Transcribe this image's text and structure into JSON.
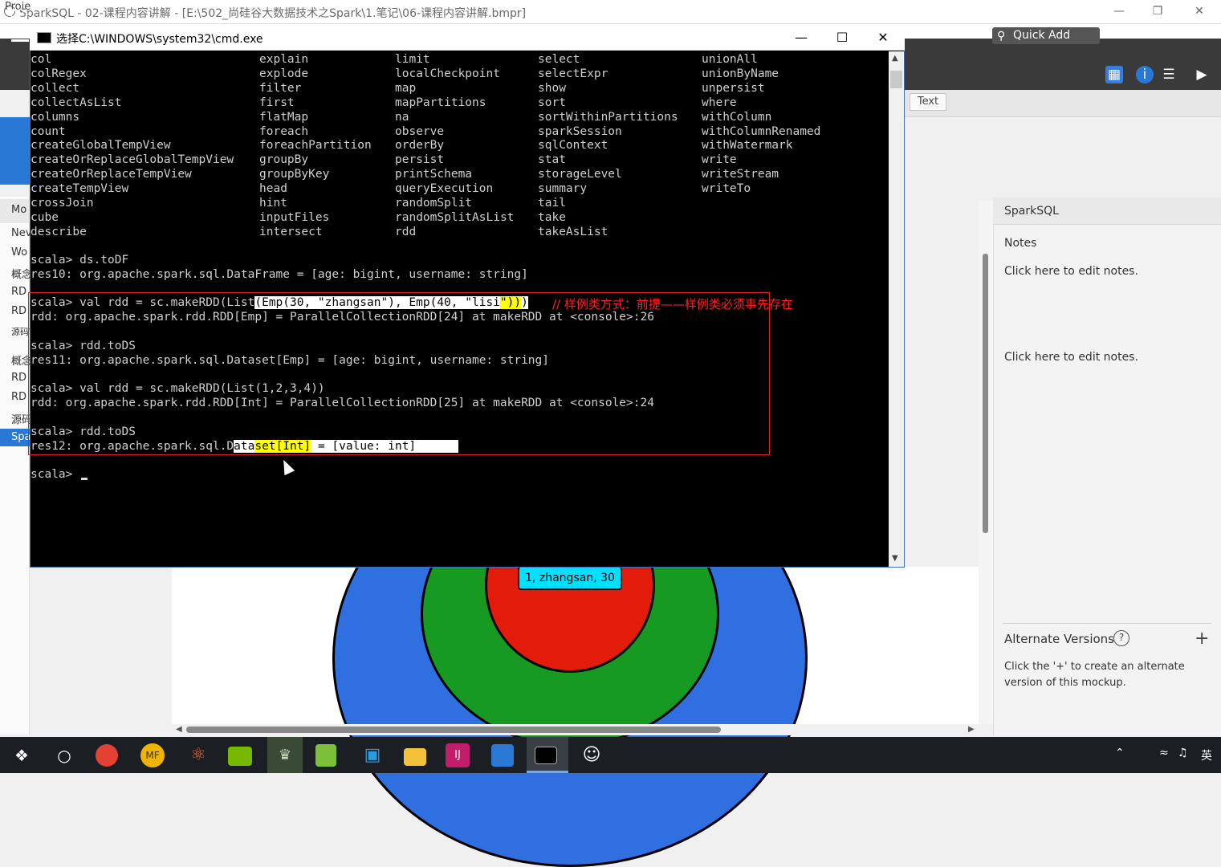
{
  "app": {
    "title": "SparkSQL - 02-课程内容讲解 - [E:\\502_尚硅谷大数据技术之Spark\\1.笔记\\06-课程内容讲解.bmpr]",
    "menu_project": "Proje",
    "toolbar_prefix": "02-",
    "quick_add": "Quick Add",
    "text_button": "Text",
    "left_header": "Mo",
    "left_items": [
      "Nev",
      "Wo",
      "概念",
      "RD",
      "RD",
      "源码Wo",
      "概念",
      "RD",
      "RD",
      "源码",
      "Spa"
    ]
  },
  "cmd": {
    "title": "选择C:\\WINDOWS\\system32\\cmd.exe",
    "completion_columns": [
      [
        "col",
        "colRegex",
        "collect",
        "collectAsList",
        "columns",
        "count",
        "createGlobalTempView",
        "createOrReplaceGlobalTempView",
        "createOrReplaceTempView",
        "createTempView",
        "crossJoin",
        "cube",
        "describe"
      ],
      [
        "explain",
        "explode",
        "filter",
        "first",
        "flatMap",
        "foreach",
        "foreachPartition",
        "groupBy",
        "groupByKey",
        "head",
        "hint",
        "inputFiles",
        "intersect"
      ],
      [
        "limit",
        "localCheckpoint",
        "map",
        "mapPartitions",
        "na",
        "observe",
        "orderBy",
        "persist",
        "printSchema",
        "queryExecution",
        "randomSplit",
        "randomSplitAsList",
        "rdd"
      ],
      [
        "select",
        "selectExpr",
        "show",
        "sort",
        "sortWithinPartitions",
        "sparkSession",
        "sqlContext",
        "stat",
        "storageLevel",
        "summary",
        "tail",
        "take",
        "takeAsList"
      ],
      [
        "unionAll",
        "unionByName",
        "unpersist",
        "where",
        "withColumn",
        "withColumnRenamed",
        "withWatermark",
        "write",
        "writeStream",
        "writeTo"
      ]
    ],
    "lines": {
      "l1": "scala> ds.toDF",
      "l2": "res10: org.apache.spark.sql.DataFrame = [age: bigint, username: string]",
      "l3a": "scala> val rdd = sc.makeRDD(List",
      "l3b": "(Emp(30, \"zhangsan\"), Emp(40, \"lisi",
      "l3c": "\"))",
      "l3d": ")",
      "l4": "rdd: org.apache.spark.rdd.RDD[Emp] = ParallelCollectionRDD[24] at makeRDD at <console>:26",
      "l5": "scala> rdd.toDS",
      "l6": "res11: org.apache.spark.sql.Dataset[Emp] = [age: bigint, username: string]",
      "l7": "scala> val rdd = sc.makeRDD(List(1,2,3,4))",
      "l8": "rdd: org.apache.spark.rdd.RDD[Int] = ParallelCollectionRDD[25] at makeRDD at <console>:24",
      "l9": "scala> rdd.toDS",
      "l10a": "res12: org.apache.spark.sql.D",
      "l10b": "ata",
      "l10c": "set[Int]",
      "l10d": " = [value: int]      ",
      "l11": "scala> "
    },
    "annotation": "// 样例类方式：前提——样例类必须事先存在"
  },
  "diagram": {
    "center_label": "1, zhangsan, 30"
  },
  "right_panel": {
    "page_name": "SparkSQL",
    "notes_label": "Notes",
    "edit_notes_1": "Click here to edit notes.",
    "edit_notes_2": "Click here to edit notes.",
    "alt_versions_label": "Alternate Versions",
    "alt_versions_help": "?",
    "alt_versions_desc_1": "Click the '+' to create an alternate",
    "alt_versions_desc_2": "version of this mockup."
  },
  "taskbar": {
    "ime": "英",
    "apps": [
      "start-icon",
      "cortana-icon",
      "chrome-icon",
      "mindfusion-icon",
      "cloud-app-icon",
      "nvidia-icon",
      "app-icon",
      "notepad-icon",
      "vmware-icon",
      "file-explorer-icon",
      "intellij-icon",
      "vmware-workstation-icon",
      "cmd-icon",
      "smiley-app-icon"
    ]
  },
  "colors": {
    "cmd_background": "#000000",
    "highlight_yellow": "#ffff00",
    "annotation_red": "#ff2020",
    "ring_blue": "#2f6fe0",
    "ring_green": "#179a22",
    "ring_red": "#e31b0a",
    "label_cyan": "#00e0ff"
  }
}
